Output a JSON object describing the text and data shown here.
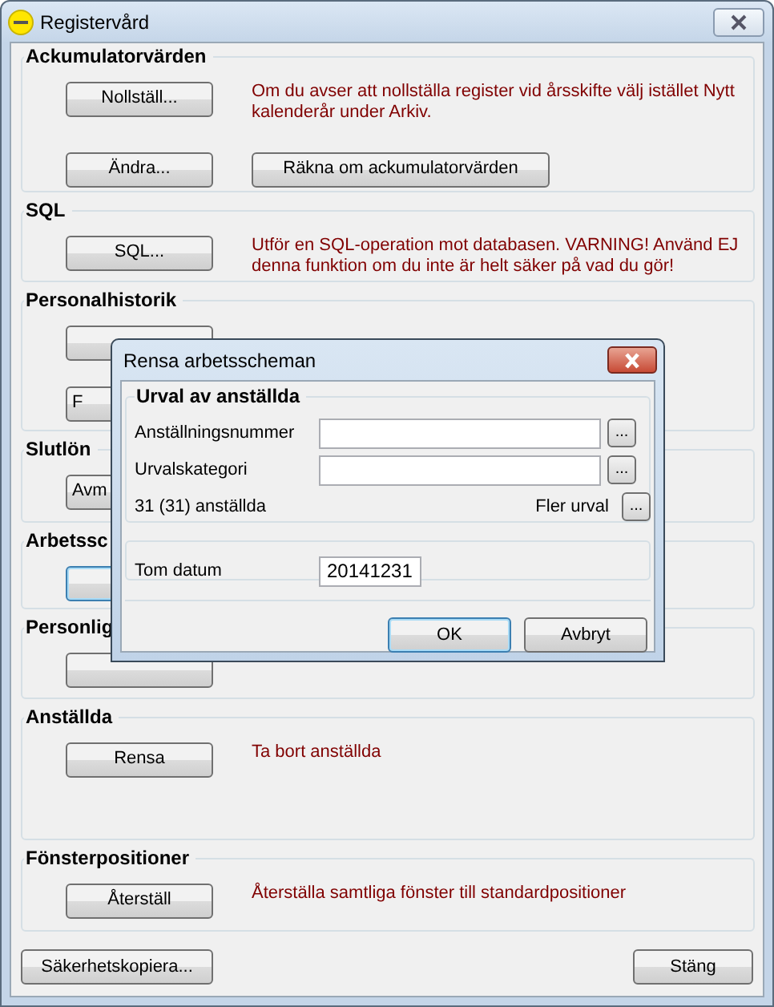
{
  "window": {
    "title": "Registervård"
  },
  "groups": [
    {
      "title": "Ackumulatorvärden",
      "rows": [
        {
          "buttons": [
            {
              "label": "Nollställ...",
              "focused": false
            }
          ],
          "note": "Om du avser att nollställa register vid årsskifte välj istället Nytt kalenderår under Arkiv."
        },
        {
          "buttons": [
            {
              "label": "Ändra...",
              "focused": false
            },
            {
              "label": "Räkna om ackumulatorvärden",
              "focused": false
            }
          ]
        }
      ]
    },
    {
      "title": "SQL",
      "rows": [
        {
          "buttons": [
            {
              "label": "SQL...",
              "focused": false
            }
          ],
          "note": "Utför en SQL-operation mot databasen. VARNING! Använd EJ denna funktion om du inte är helt säker på vad du gör!"
        }
      ]
    },
    {
      "title": "Personalhistorik",
      "rows": [
        {
          "buttons": [
            {
              "focused": false
            }
          ]
        },
        {
          "buttons": [
            {
              "label": "F",
              "focused": false,
              "partial": true
            }
          ]
        }
      ]
    },
    {
      "title": "Slutlön",
      "rows": [
        {
          "buttons": [
            {
              "label": "Avm",
              "focused": false,
              "partial": true
            }
          ]
        }
      ]
    },
    {
      "title": "Arbetssc",
      "rows": [
        {
          "buttons": [
            {
              "focused": true
            }
          ]
        }
      ]
    },
    {
      "title": "Personlig",
      "rows": [
        {
          "buttons": [
            {
              "focused": false
            }
          ]
        }
      ]
    },
    {
      "title": "Anställda",
      "rows": [
        {
          "buttons": [
            {
              "label": "Rensa",
              "focused": false
            }
          ],
          "note": "Ta bort anställda"
        }
      ]
    },
    {
      "title": "Fönsterpositioner",
      "rows": [
        {
          "buttons": [
            {
              "label": "Återställ",
              "focused": false
            }
          ],
          "note": "Återställa samtliga fönster till standardpositioner"
        }
      ]
    }
  ],
  "footer_buttons": [
    {
      "label": "Säkerhetskopiera...",
      "focused": false
    },
    {
      "label": "Stäng",
      "focused": false
    }
  ],
  "dialog": {
    "title": "Rensa arbetsscheman",
    "group_title": "Urval av anställda",
    "fields": [
      {
        "label": "Anställningsnummer"
      },
      {
        "label": "Urvalskategori"
      }
    ],
    "count": "31 (31) anställda",
    "more_label": "Fler urval",
    "browse_button": "...",
    "date_label": "Tom datum",
    "date_value": "20141231",
    "buttons": [
      {
        "label": "OK",
        "focused": true
      },
      {
        "label": "Avbryt",
        "focused": false
      }
    ]
  }
}
